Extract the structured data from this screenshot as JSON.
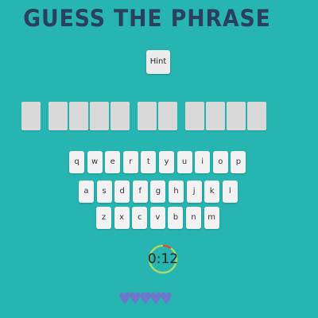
{
  "title": "GUESS THE PHRASE",
  "hint_label": "Hint",
  "phrase": {
    "words": [
      1,
      4,
      2,
      4
    ]
  },
  "keyboard": {
    "rows": [
      [
        "q",
        "w",
        "e",
        "r",
        "t",
        "y",
        "u",
        "i",
        "o",
        "p"
      ],
      [
        "a",
        "s",
        "d",
        "f",
        "g",
        "h",
        "j",
        "k",
        "l"
      ],
      [
        "z",
        "x",
        "c",
        "v",
        "b",
        "n",
        "m"
      ]
    ]
  },
  "timer": {
    "text": "0:12",
    "track_color": "#a8d86e",
    "progress_color": "#e04a3a",
    "remaining_fraction": 0.9
  },
  "lives": {
    "count": 5,
    "color": "#6c78c9"
  },
  "colors": {
    "background": "#26b5b0",
    "title": "#2b3f5e",
    "tile": "#d9d9d9",
    "key": "#f2f2f2"
  }
}
